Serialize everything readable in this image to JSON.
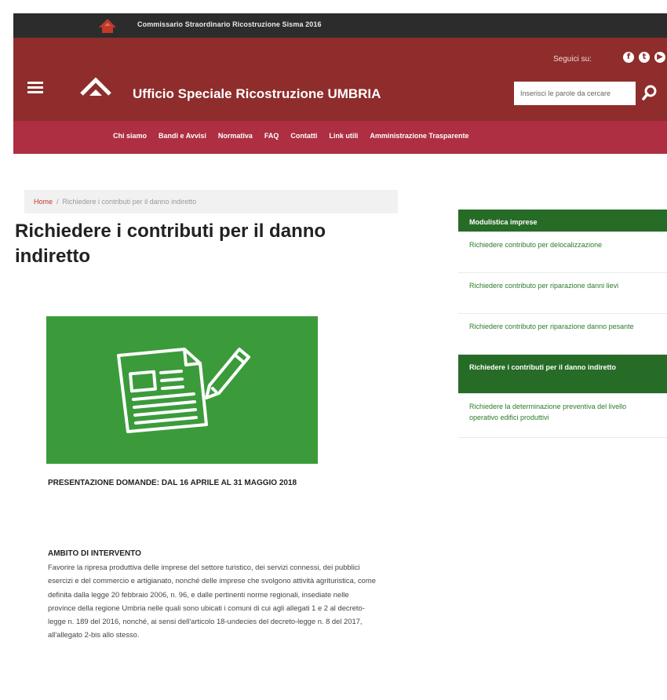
{
  "topbar": {
    "text": "Commissario Straordinario Ricostruzione Sisma 2016"
  },
  "header": {
    "site_title": "Ufficio Speciale Ricostruzione UMBRIA",
    "follow_label": "Seguici su:",
    "social_icons": [
      "facebook-icon",
      "twitter-icon",
      "youtube-icon"
    ],
    "search_placeholder": "Inserisci le parole da cercare"
  },
  "nav": {
    "items": [
      {
        "label": "Chi siamo"
      },
      {
        "label": "Bandi e Avvisi"
      },
      {
        "label": "Normativa"
      },
      {
        "label": "FAQ"
      },
      {
        "label": "Contatti"
      },
      {
        "label": "Link utili"
      },
      {
        "label": "Amministrazione Trasparente"
      }
    ]
  },
  "breadcrumb": {
    "home": "Home",
    "separator": "/",
    "current": "Richiedere i contributi per il danno indiretto"
  },
  "page": {
    "title": "Richiedere i contributi per il danno indiretto",
    "presentazione": "PRESENTAZIONE DOMANDE: DAL 16 APRILE AL 31 MAGGIO 2018",
    "ambito_heading": "AMBITO DI INTERVENTO",
    "ambito_text": "Favorire la ripresa produttiva delle imprese del settore turistico, dei servizi connessi, dei pubblici esercizi e del commercio e artigianato, nonché delle imprese che svolgono attività agrituristica, come definita dalla legge 20 febbraio 2006, n. 96, e dalle pertinenti norme regionali, insediate nelle province della regione Umbria nelle quali sono ubicati i comuni di cui agli allegati 1 e 2 al decreto-legge n. 189 del 2016, nonché, ai sensi dell'articolo 18-undecies del decreto-legge n. 8 del 2017, all'allegato 2-bis allo stesso."
  },
  "sidebar": {
    "heading": "Modulistica imprese",
    "items": [
      {
        "label": "Richiedere contributo per delocalizzazione"
      },
      {
        "label": "Richiedere contributo per riparazione danni lievi"
      },
      {
        "label": "Richiedere contributo per riparazione danno pesante"
      },
      {
        "label": "Richiedere i contributi per il danno indiretto"
      },
      {
        "label": "Richiedere la determinazione preventiva del livello operativo edifici produttivi"
      }
    ]
  },
  "colors": {
    "topbar": "#2c2c2c",
    "header": "#8e2d2b",
    "nav": "#ad2f41",
    "sidebar_green": "#266b26",
    "hero_green": "#3b9b3b"
  }
}
